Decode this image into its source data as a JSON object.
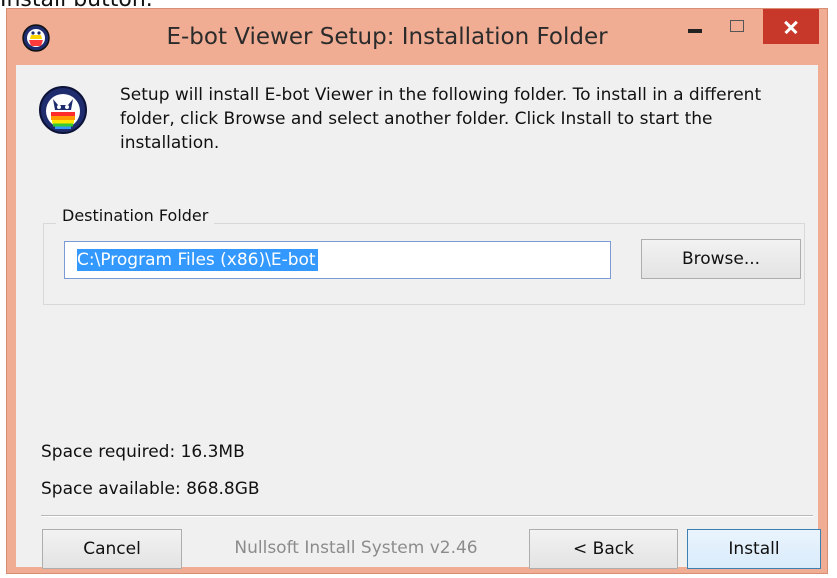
{
  "caption": "Install button.",
  "window": {
    "title": "E-bot Viewer Setup: Installation Folder",
    "controls": {
      "minimize": "minimize",
      "maximize": "maximize",
      "close": "close"
    }
  },
  "header": {
    "text": "Setup will install E-bot Viewer in the following folder. To install in a different folder, click Browse and select another folder. Click Install to start the installation."
  },
  "destination": {
    "group_label": "Destination Folder",
    "path": "C:\\Program Files (x86)\\E-bot",
    "browse_label": "Browse..."
  },
  "space": {
    "required": "Space required: 16.3MB",
    "available": "Space available: 868.8GB"
  },
  "footer": {
    "branding": "Nullsoft Install System v2.46",
    "cancel_label": "Cancel",
    "back_label": "< Back",
    "install_label": "Install"
  },
  "colors": {
    "window_frame": "#f0ad93",
    "close_button": "#c7382a",
    "selection": "#3399ff",
    "install_border": "#3c7fb1"
  }
}
